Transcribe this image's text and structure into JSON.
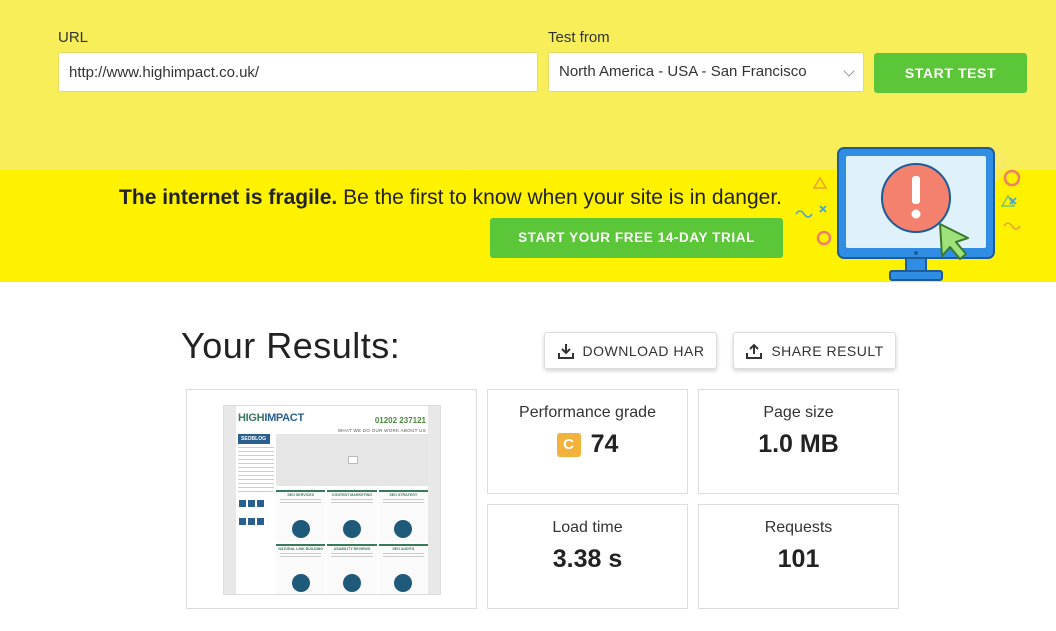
{
  "form": {
    "url_label": "URL",
    "url_value": "http://www.highimpact.co.uk/",
    "location_label": "Test from",
    "location_value": "North America - USA - San Francisco",
    "start_button": "START TEST"
  },
  "banner": {
    "tagline_bold": "The internet is fragile.",
    "tagline_rest": " Be the first to know when your site is in danger.",
    "trial_button": "START YOUR FREE 14-DAY TRIAL"
  },
  "results": {
    "title": "Your Results:",
    "download_har": "DOWNLOAD HAR",
    "share_result": "SHARE RESULT",
    "performance_label": "Performance grade",
    "performance_letter": "C",
    "performance_score": "74",
    "page_size_label": "Page size",
    "page_size_value": "1.0 MB",
    "load_time_label": "Load time",
    "load_time_value": "3.38 s",
    "requests_label": "Requests",
    "requests_value": "101"
  },
  "thumbnail": {
    "logo_a": "HIGH",
    "logo_b": "IMPACT",
    "phone": "01202 237121",
    "nav": "WHAT WE DO   OUR WORK   ABOUT US",
    "blog": "SEOBLOG",
    "cells": [
      "SEO SERVICES",
      "CONTENT MARKETING",
      "SEO STRATEGY",
      "NATURAL LINK BUILDING",
      "USABILITY REVIEWS",
      "SEO AUDITS"
    ]
  },
  "colors": {
    "topbar": "#f7ee5a",
    "banner": "#fff200",
    "green_button": "#5cc639",
    "grade_badge": "#f2b23c"
  }
}
